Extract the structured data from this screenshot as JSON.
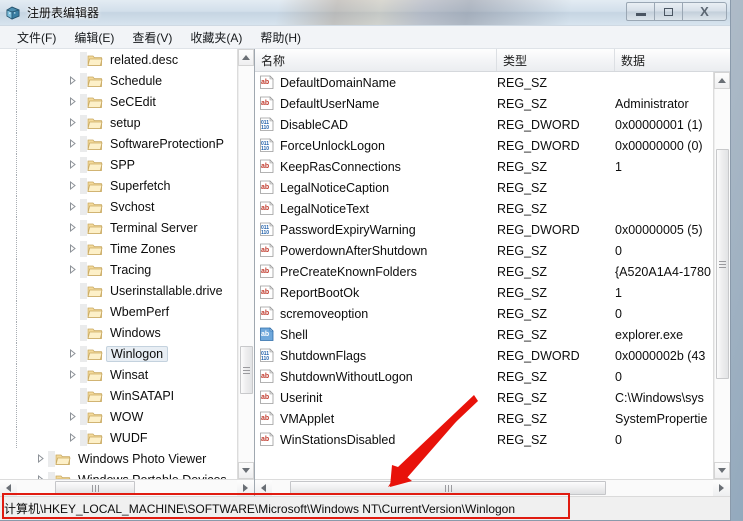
{
  "window": {
    "title": "注册表编辑器",
    "icon": "registry-editor-icon",
    "buttons": {
      "minimize": "minimize",
      "maximize": "maximize",
      "close": "X"
    }
  },
  "menu": [
    {
      "label": "文件(F)"
    },
    {
      "label": "编辑(E)"
    },
    {
      "label": "查看(V)"
    },
    {
      "label": "收藏夹(A)"
    },
    {
      "label": "帮助(H)"
    }
  ],
  "tree": {
    "nodes": [
      {
        "label": "related.desc",
        "indent": 4,
        "expander": false,
        "selected": false
      },
      {
        "label": "Schedule",
        "indent": 4,
        "expander": true,
        "selected": false
      },
      {
        "label": "SeCEdit",
        "indent": 4,
        "expander": true,
        "selected": false
      },
      {
        "label": "setup",
        "indent": 4,
        "expander": true,
        "selected": false
      },
      {
        "label": "SoftwareProtectionP",
        "indent": 4,
        "expander": true,
        "selected": false
      },
      {
        "label": "SPP",
        "indent": 4,
        "expander": true,
        "selected": false
      },
      {
        "label": "Superfetch",
        "indent": 4,
        "expander": true,
        "selected": false
      },
      {
        "label": "Svchost",
        "indent": 4,
        "expander": true,
        "selected": false
      },
      {
        "label": "Terminal Server",
        "indent": 4,
        "expander": true,
        "selected": false
      },
      {
        "label": "Time Zones",
        "indent": 4,
        "expander": true,
        "selected": false
      },
      {
        "label": "Tracing",
        "indent": 4,
        "expander": true,
        "selected": false
      },
      {
        "label": "Userinstallable.drive",
        "indent": 4,
        "expander": false,
        "selected": false
      },
      {
        "label": "WbemPerf",
        "indent": 4,
        "expander": false,
        "selected": false
      },
      {
        "label": "Windows",
        "indent": 4,
        "expander": false,
        "selected": false
      },
      {
        "label": "Winlogon",
        "indent": 4,
        "expander": true,
        "selected": true
      },
      {
        "label": "Winsat",
        "indent": 4,
        "expander": true,
        "selected": false
      },
      {
        "label": "WinSATAPI",
        "indent": 4,
        "expander": false,
        "selected": false
      },
      {
        "label": "WOW",
        "indent": 4,
        "expander": true,
        "selected": false
      },
      {
        "label": "WUDF",
        "indent": 4,
        "expander": true,
        "selected": false
      },
      {
        "label": "Windows Photo Viewer",
        "indent": 2,
        "expander": true,
        "selected": false
      },
      {
        "label": "Windows Portable Devices",
        "indent": 2,
        "expander": true,
        "selected": false
      }
    ]
  },
  "list": {
    "columns": {
      "name": "名称",
      "type": "类型",
      "data": "数据"
    },
    "rows": [
      {
        "name": "DefaultDomainName",
        "type": "REG_SZ",
        "data": "",
        "icon": "string-value-icon"
      },
      {
        "name": "DefaultUserName",
        "type": "REG_SZ",
        "data": "Administrator",
        "icon": "string-value-icon"
      },
      {
        "name": "DisableCAD",
        "type": "REG_DWORD",
        "data": "0x00000001 (1)",
        "icon": "dword-value-icon"
      },
      {
        "name": "ForceUnlockLogon",
        "type": "REG_DWORD",
        "data": "0x00000000 (0)",
        "icon": "dword-value-icon"
      },
      {
        "name": "KeepRasConnections",
        "type": "REG_SZ",
        "data": "1",
        "icon": "string-value-icon"
      },
      {
        "name": "LegalNoticeCaption",
        "type": "REG_SZ",
        "data": "",
        "icon": "string-value-icon"
      },
      {
        "name": "LegalNoticeText",
        "type": "REG_SZ",
        "data": "",
        "icon": "string-value-icon"
      },
      {
        "name": "PasswordExpiryWarning",
        "type": "REG_DWORD",
        "data": "0x00000005 (5)",
        "icon": "dword-value-icon"
      },
      {
        "name": "PowerdownAfterShutdown",
        "type": "REG_SZ",
        "data": "0",
        "icon": "string-value-icon"
      },
      {
        "name": "PreCreateKnownFolders",
        "type": "REG_SZ",
        "data": "{A520A1A4-1780",
        "icon": "string-value-icon"
      },
      {
        "name": "ReportBootOk",
        "type": "REG_SZ",
        "data": "1",
        "icon": "string-value-icon"
      },
      {
        "name": "scremoveoption",
        "type": "REG_SZ",
        "data": "0",
        "icon": "string-value-icon"
      },
      {
        "name": "Shell",
        "type": "REG_SZ",
        "data": "explorer.exe",
        "icon": "string-value-icon-selected"
      },
      {
        "name": "ShutdownFlags",
        "type": "REG_DWORD",
        "data": "0x0000002b (43",
        "icon": "dword-value-icon"
      },
      {
        "name": "ShutdownWithoutLogon",
        "type": "REG_SZ",
        "data": "0",
        "icon": "string-value-icon"
      },
      {
        "name": "Userinit",
        "type": "REG_SZ",
        "data": "C:\\Windows\\sys",
        "icon": "string-value-icon"
      },
      {
        "name": "VMApplet",
        "type": "REG_SZ",
        "data": "SystemPropertie",
        "icon": "string-value-icon"
      },
      {
        "name": "WinStationsDisabled",
        "type": "REG_SZ",
        "data": "0",
        "icon": "string-value-icon"
      }
    ]
  },
  "statusbar": {
    "path": "计算机\\HKEY_LOCAL_MACHINE\\SOFTWARE\\Microsoft\\Windows NT\\CurrentVersion\\Winlogon"
  },
  "annotations": {
    "highlight_color": "#e01b10",
    "arrow_color": "#e01b10"
  }
}
